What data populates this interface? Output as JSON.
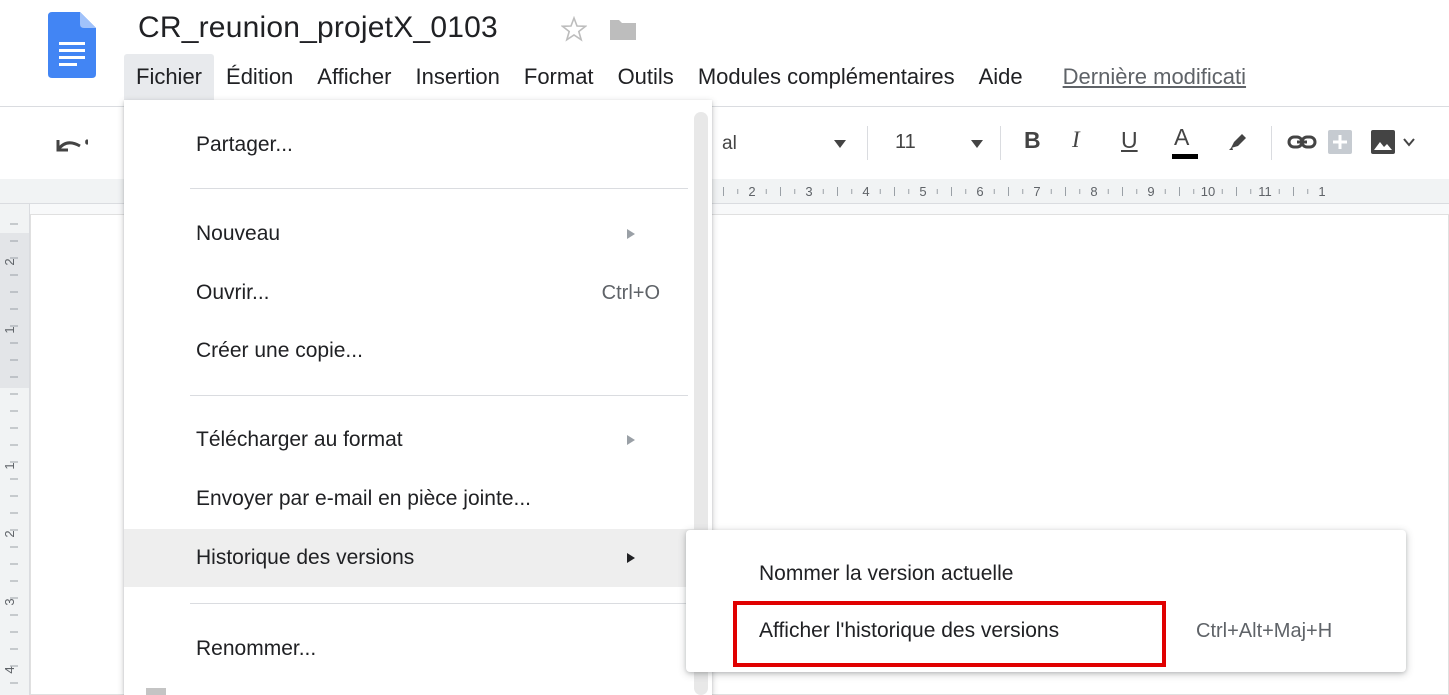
{
  "document": {
    "title": "CR_reunion_projetX_0103"
  },
  "menubar": {
    "items": [
      "Fichier",
      "Édition",
      "Afficher",
      "Insertion",
      "Format",
      "Outils",
      "Modules complémentaires",
      "Aide"
    ],
    "active_index": 0,
    "last_modified": "Dernière modificati"
  },
  "toolbar": {
    "font_name_visible": "al",
    "font_size": "11",
    "bold": "B",
    "italic": "I",
    "underline": "U",
    "text_color": "A",
    "icons": [
      "undo-icon",
      "highlight-icon",
      "link-icon",
      "comment-icon",
      "image-icon"
    ]
  },
  "ruler": {
    "top_numbers": [
      "2",
      "3",
      "4",
      "5",
      "6",
      "7",
      "8",
      "9",
      "10",
      "11",
      "1"
    ],
    "left_numbers": [
      "2",
      "1",
      "1",
      "2",
      "3",
      "4"
    ]
  },
  "file_menu": {
    "items": [
      {
        "label": "Partager...",
        "shortcut": "",
        "submenu": false
      },
      {
        "label": "Nouveau",
        "shortcut": "",
        "submenu": true
      },
      {
        "label": "Ouvrir...",
        "shortcut": "Ctrl+O",
        "submenu": false
      },
      {
        "label": "Créer une copie...",
        "shortcut": "",
        "submenu": false
      },
      {
        "label": "Télécharger au format",
        "shortcut": "",
        "submenu": true
      },
      {
        "label": "Envoyer par e-mail en pièce jointe...",
        "shortcut": "",
        "submenu": false
      },
      {
        "label": "Historique des versions",
        "shortcut": "",
        "submenu": true
      },
      {
        "label": "Renommer...",
        "shortcut": "",
        "submenu": false
      }
    ],
    "highlighted": "Historique des versions"
  },
  "version_submenu": {
    "items": [
      {
        "label": "Nommer la version actuelle",
        "shortcut": ""
      },
      {
        "label": "Afficher l'historique des versions",
        "shortcut": "Ctrl+Alt+Maj+H"
      }
    ]
  },
  "colors": {
    "docs_blue": "#4285f4",
    "highlight_box": "#e00000",
    "menu_hover": "#eeeeee"
  }
}
